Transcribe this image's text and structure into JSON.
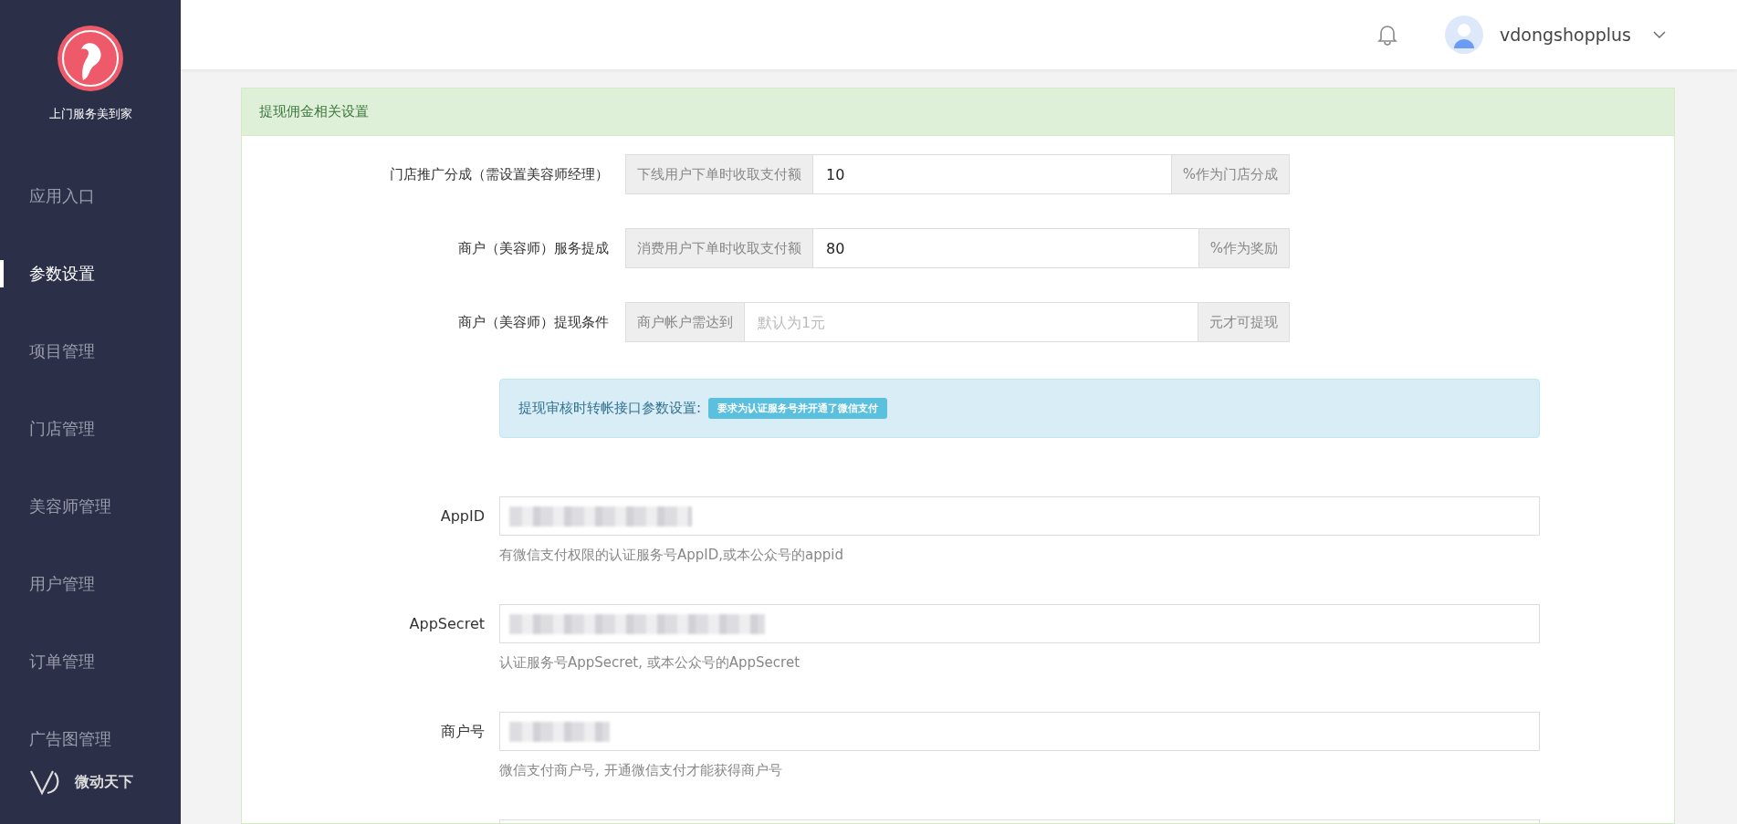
{
  "brand": {
    "name": "上门服务美到家"
  },
  "sidebar": {
    "items": [
      {
        "label": "应用入口",
        "selected": false
      },
      {
        "label": "参数设置",
        "selected": true
      },
      {
        "label": "项目管理",
        "selected": false
      },
      {
        "label": "门店管理",
        "selected": false
      },
      {
        "label": "美容师管理",
        "selected": false
      },
      {
        "label": "用户管理",
        "selected": false
      },
      {
        "label": "订单管理",
        "selected": false
      },
      {
        "label": "广告图管理",
        "selected": false
      }
    ],
    "footer": "微动天下"
  },
  "header": {
    "username": "vdongshopplus"
  },
  "panel": {
    "title": "提现佣金相关设置",
    "rows": [
      {
        "label": "门店推广分成（需设置美容师经理）",
        "prefix": "下线用户下单时收取支付额",
        "value": "10",
        "suffix": "%作为门店分成"
      },
      {
        "label": "商户（美容师）服务提成",
        "prefix": "消费用户下单时收取支付额",
        "value": "80",
        "suffix": "%作为奖励"
      },
      {
        "label": "商户（美容师）提现条件",
        "prefix": "商户帐户需达到",
        "placeholder": "默认为1元",
        "suffix": "元才可提现"
      }
    ],
    "notice": {
      "text": "提现审核时转帐接口参数设置:",
      "badge": "要求为认证服务号并开通了微信支付"
    },
    "api_fields": [
      {
        "label": "AppID",
        "masked": true,
        "help": "有微信支付权限的认证服务号AppID,或本公众号的appid"
      },
      {
        "label": "AppSecret",
        "masked": true,
        "help": "认证服务号AppSecret, 或本公众号的AppSecret"
      },
      {
        "label": "商户号",
        "masked": true,
        "help": "微信支付商户号, 开通微信支付才能获得商户号"
      },
      {
        "masked": false
      }
    ]
  }
}
